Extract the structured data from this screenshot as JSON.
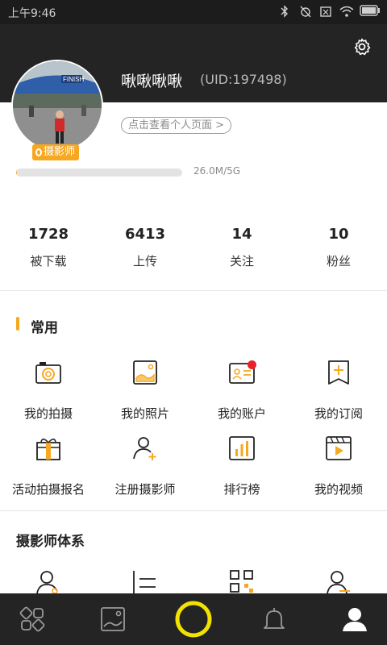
{
  "status_bar": {
    "time": "上午9:46"
  },
  "profile": {
    "username": "啾啾啾啾",
    "uid": "(UID:197498)",
    "profile_link": "点击查看个人页面 >",
    "badge": "摄影师",
    "storage_text": "26.0M/5G",
    "storage_fraction": 0.005
  },
  "stats": [
    {
      "value": "1728",
      "label": "被下载"
    },
    {
      "value": "6413",
      "label": "上传"
    },
    {
      "value": "14",
      "label": "关注"
    },
    {
      "value": "10",
      "label": "粉丝"
    }
  ],
  "common": {
    "title": "常用",
    "items": [
      {
        "label": "我的拍摄",
        "icon": "camera-icon"
      },
      {
        "label": "我的照片",
        "icon": "photo-icon"
      },
      {
        "label": "我的账户",
        "icon": "account-card-icon",
        "badge": "red-dot"
      },
      {
        "label": "我的订阅",
        "icon": "bookmark-icon"
      },
      {
        "label": "活动拍摄报名",
        "icon": "gift-box-icon"
      },
      {
        "label": "注册摄影师",
        "icon": "add-user-icon"
      },
      {
        "label": "排行榜",
        "icon": "ranking-icon"
      },
      {
        "label": "我的视频",
        "icon": "video-icon"
      }
    ]
  },
  "photographer_system": {
    "title": "摄影师体系"
  },
  "colors": {
    "accent": "#f7a823",
    "header_bg": "#242424",
    "alert": "#e8212b"
  },
  "bottom_nav": [
    "discover-icon",
    "gallery-icon",
    "capture-ring-icon",
    "bell-icon",
    "profile-icon"
  ]
}
